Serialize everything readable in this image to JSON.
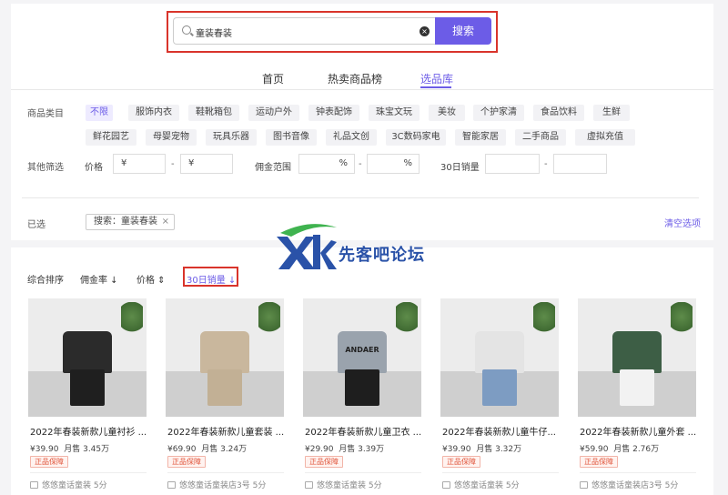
{
  "search": {
    "value": "童装春装",
    "button_label": "搜索"
  },
  "nav": {
    "tabs": [
      {
        "label": "首页"
      },
      {
        "label": "热卖商品榜"
      },
      {
        "label": "选品库"
      }
    ],
    "active_tab": 2
  },
  "filters": {
    "category_label": "商品类目",
    "categories_row1": [
      "不限",
      "服饰内衣",
      "鞋靴箱包",
      "运动户外",
      "钟表配饰",
      "珠宝文玩",
      "美妆",
      "个护家清",
      "食品饮料",
      "生鲜"
    ],
    "categories_row2": [
      "鲜花园艺",
      "母婴宠物",
      "玩具乐器",
      "图书音像",
      "礼品文创",
      "3C数码家电",
      "智能家居",
      "二手商品",
      "虚拟充值"
    ],
    "other_label": "其他筛选",
    "price_label": "价格",
    "price_min_prefix": "¥",
    "price_max_prefix": "¥",
    "commission_label": "佣金范围",
    "commission_min_suffix": "%",
    "commission_max_suffix": "%",
    "sales_label": "30日销量",
    "dash": "-"
  },
  "selected": {
    "label": "已选",
    "tag": "搜索：童装春装",
    "tag_close": "×",
    "clear_label": "清空选项"
  },
  "watermark": {
    "text": "先客吧论坛",
    "logo": "XK"
  },
  "sort": {
    "items": [
      "综合排序",
      "佣金率 ↓",
      "价格 ⇕",
      "30日销量 ↓"
    ],
    "active": 3
  },
  "products": [
    {
      "title": "2022年春装新款儿童衬衫 ...",
      "price": "¥39.90",
      "sales": "月售 3.45万",
      "badge": "正品保障",
      "store": "悠悠童话童装 5分",
      "image_text": "",
      "top_color": "#2b2b2b",
      "pants_color": "#1f1f1f"
    },
    {
      "title": "2022年春装新款儿童套装 ...",
      "price": "¥69.90",
      "sales": "月售 3.24万",
      "badge": "正品保障",
      "store": "悠悠童话童装店3号 5分",
      "image_text": "",
      "top_color": "#c9b79d",
      "pants_color": "#c2b095"
    },
    {
      "title": "2022年春装新款儿童卫衣 ...",
      "price": "¥29.90",
      "sales": "月售 3.39万",
      "badge": "正品保障",
      "store": "悠悠童话童装 5分",
      "image_text": "ANDAER",
      "top_color": "#9aa3ad",
      "pants_color": "#1e1e1e"
    },
    {
      "title": "2022年春装新款儿童牛仔...",
      "price": "¥39.90",
      "sales": "月售 3.32万",
      "badge": "正品保障",
      "store": "悠悠童话童装 5分",
      "image_text": "",
      "top_color": "#e4e4e4",
      "pants_color": "#7d9cc2"
    },
    {
      "title": "2022年春装新款儿童外套 ...",
      "price": "¥59.90",
      "sales": "月售 2.76万",
      "badge": "正品保障",
      "store": "悠悠童话童装店3号 5分",
      "image_text": "",
      "top_color": "#3d5e45",
      "pants_color": "#f2f2f2"
    }
  ],
  "colors": {
    "accent": "#6c5ce7",
    "highlight_red": "#d9342b",
    "badge_red": "#e0553b"
  }
}
